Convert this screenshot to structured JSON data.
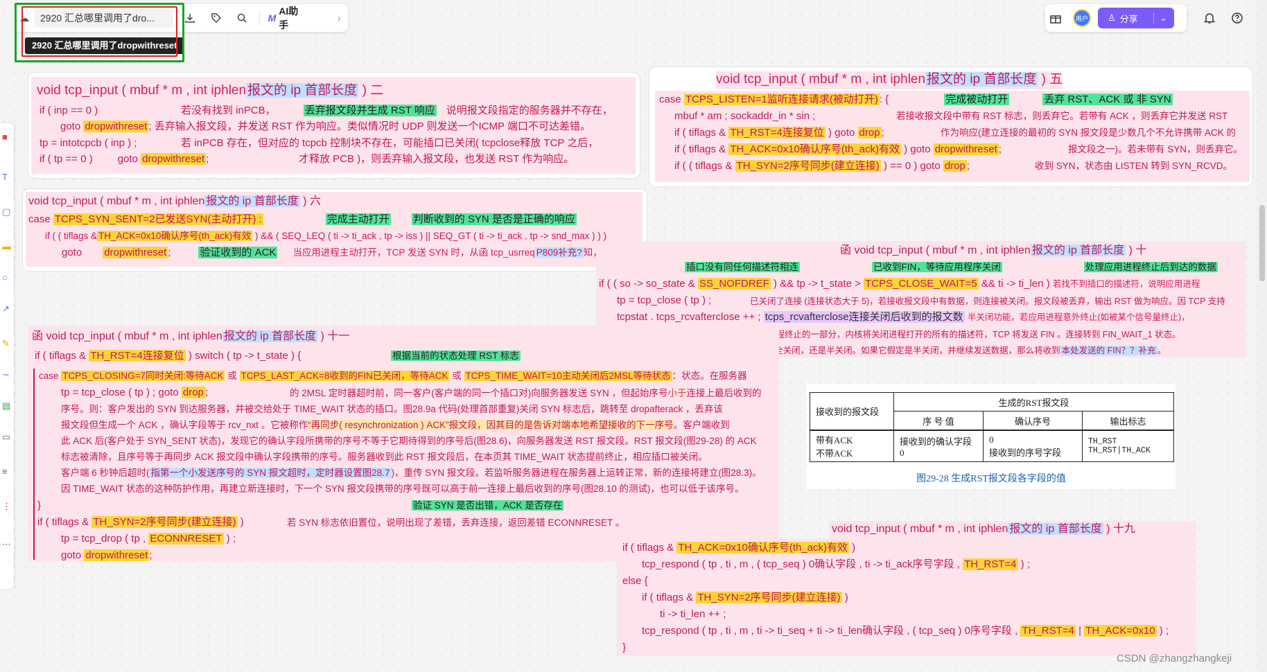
{
  "toolbar": {
    "doc_title": "2920 汇总哪里调用了dro...",
    "tooltip": "2920 汇总哪里调用了dropwithreset",
    "ai_label": "AI助手",
    "more_glyph": "›"
  },
  "right_toolbar": {
    "avatar_label": "用户",
    "share_label": "分享"
  },
  "card2": {
    "h_a": "void   tcp_input ( mbuf * m , int  iphlen",
    "h_b": "报文的 ip 首部长度",
    "h_c": " )    二",
    "l1_a": "if ( inp == 0 )",
    "l1_b": "若没有找到 inPCB，",
    "l1_c": "丢弃报文段并生成 RST 响应",
    "l1_d": "说明报文段指定的服务器并不存在，",
    "l2_a": "goto",
    "l2_b": "dropwithreset",
    "l2_c": ";   丢弃输入报文段，并发送 RST 作为响应。类似情况时 UDP 则发送一个ICMP 端口不可达差错。",
    "l3_a": "tp = intotcpcb ( inp ) ;",
    "l3_b": "若 inPCB 存在，但对应的 tcpcb 控制块不存在，可能插口已关闭( tcpclose释放 TCP 之后，",
    "l4_a": "if ( tp == 0 )",
    "l4_b": "goto",
    "l4_c": "dropwithreset",
    "l4_d": ";",
    "l4_e": "才释放 PCB )，则丢弃输入报文段，也发送 RST 作为响应。"
  },
  "card5": {
    "h_a": "void   tcp_input ( mbuf * m , int  iphlen",
    "h_b": "报文的 ip 首部长度",
    "h_c": " )    五",
    "l1_a": "case",
    "l1_b": "TCPS_LISTEN=1监听连接请求(被动打开)",
    "l1_c": ": {",
    "l1_d": "完成被动打开",
    "l1_e": "丢弃 RST、ACK 或 非 SYN",
    "l2_a": "mbuf * am ;      sockaddr_in * sin ;",
    "l2_b": "若接收报文段中带有 RST 标志，则丢弃它。若带有 ACK ，则丢弃它并发送 RST",
    "l3_a": "if ( tiflags  &",
    "l3_b": "TH_RST=4连接复位",
    "l3_c": " )     goto",
    "l3_d": "drop",
    "l3_e": ";",
    "l3_f": "作为响应(建立连接的最初的 SYN 报文段是少数几个不允许携带 ACK 的",
    "l4_a": "if ( tiflags  &",
    "l4_b": "TH_ACK=0x10确认序号(th_ack)有效",
    "l4_c": " )     goto",
    "l4_d": "dropwithreset",
    "l4_e": ";",
    "l4_f": "报文段之一)。若未带有 SYN，则丢弃它。",
    "l5_a": "if ( ( tiflags  &",
    "l5_b": "TH_SYN=2序号同步(建立连接)",
    "l5_c": " )  == 0 )     goto",
    "l5_d": "drop",
    "l5_e": ";",
    "l5_f": "收到 SYN，状态由 LISTEN 转到 SYN_RCVD。"
  },
  "card6": {
    "h_a": "void   tcp_input ( mbuf * m , int  iphlen",
    "h_b": "报文的 ip 首部长度",
    "h_c": " )   六",
    "l1_a": "case",
    "l1_b": "TCPS_SYN_SENT=2已发送SYN(主动打开) :",
    "l1_c": "完成主动打开",
    "l1_d": "判断收到的 SYN 是否是正确的响应",
    "l2_a": "if ( ( tiflags &",
    "l2_b": "TH_ACK=0x10确认序号(th_ack)有效",
    "l2_c": " )  && ( SEQ_LEQ ( ti -> ti_ack , tp -> iss ) || SEQ_GT ( ti -> ti_ack , tp -> snd_max ) ) )",
    "l3_a": "goto",
    "l3_b": "dropwithreset",
    "l3_c": ";",
    "l3_d": "验证收到的 ACK",
    "l3_e": "当应用进程主动打开，TCP 发送 SYN 时，从函 tcp_usrreq",
    "l3_f": "P809补充?",
    "l3_g": "知，"
  },
  "card10": {
    "h_a": "函    void   tcp_input ( mbuf * m , int  iphlen",
    "h_b": "报文的 ip 首部长度",
    "h_c": " ) 十",
    "l1_a": "插口没有同任何描述符相连",
    "l1_b": "已收到FIN，等待应用程序关闭",
    "l1_c": "处理应用进程终止后到达的数据",
    "l2_a": "if ( ( so -> so_state  &",
    "l2_b": "SS_NOFDREF",
    "l2_c": " )  && tp -> t_state  >",
    "l2_d": "TCPS_CLOSE_WAIT=5",
    "l2_e": " && ti -> ti_len )",
    "l2_f": "若找不到插口的描述符，说明应用进程",
    "l3_a": "tp = tcp_close ( tp ) ;",
    "l3_b": "已关闭了连接 (连接状态大于 5)，若接收报文段中有数据，则连接被关闭。报文段被丢弃，输出 RST 做为响应。因 TCP 支持",
    "l4_a": "tcpstat . tcps_rcvafterclose ++ ;",
    "l4_b": "tcps_rcvafterclose连接关闭后收到的报文数",
    "l4_c": "半关闭功能，若应用进程意外终止(如被某个信号量终止)，",
    "l5_a": "goto",
    "l5_b": "dropwithreset",
    "l5_c": ";",
    "l5_d": "做为进程终止的一部分，内核将关闭进程打开的所有的描述符，TCP 将发送 FIN 。连接转到 FIN_WAIT_1 状态。",
    "l6_a": "因 FIN 的接收者无法知道对端执行的是完全关闭，还是半关闭。如果它假定是半关闭，并继续发送数据，那么将收到",
    "l6_b": "本处发送的 FIN？？补充",
    "l6_c": "。"
  },
  "card11": {
    "h_a": "函    void   tcp_input ( mbuf * m , int  iphlen",
    "h_b": "报文的 ip 首部长度",
    "h_c": " ) 十一",
    "l1_a": "if ( tiflags  &",
    "l1_b": "TH_RST=4连接复位",
    "l1_c": " )    switch ( tp -> t_state ) {",
    "l1_d": "根据当前的状态处理 RST 标志",
    "l2_a": "case",
    "l2_b": "TCPS_CLOSING=7同时关闭:等待ACK",
    "l2_c": "或",
    "l2_d": "TCPS_LAST_ACK=8收到的FIN已关闭，等待ACK",
    "l2_e": "或",
    "l2_f": "TCPS_TIME_WAIT=10主动关闭后2MSL等待状态",
    "l2_g": "：状态。在服务器",
    "l3_a": "tp = tcp_close ( tp ) ;       goto",
    "l3_b": "drop",
    "l3_c": ";",
    "l3_d": "的 2MSL 定时器超时前，同一客户(客户端的同一个插口对)向服务器发送 SYN ，但起始序号",
    "l3_e": "小于",
    "l3_f": "连接上最后收到的",
    "l4": "序号。则：客户发出的 SYN 到达服务器，并被交给处于 TIME_WAIT 状态的插口。图28.9a 代码(处理首部重复)关闭 SYN 标志后，跳转至 dropafterack ，丢弃该",
    "l5_a": "报文段但生成一个 ACK ，确认字段等于 rcv_nxt 。它被称作",
    "l5_b": "“再同步( resynchronization ) ACK”报文段，因其目的是告诉对端本地希望接收的下一序号",
    "l5_c": "。客户端收到",
    "l6": "此 ACK 后(客户处于 SYN_SENT 状态)，发现它的确认字段所携带的序号不等于它期待得到的序号后(图28.6)，向服务器发送 RST 报文段。RST 报文段(图29-28) 的 ACK",
    "l7": "标志被清除，且序号等于再同步 ACK 报文段中确认字段携带的序号。服务器收到此 RST 报文段后，在本页其 TIME_WAIT 状态提前终止，相应插口被关闭。",
    "l8_a": "客户端 6 秒钟后超时(",
    "l8_b": "指第一个小发送序号的 SYN 报文超时，定时器设置图28.7",
    "l8_c": ")，重传 SYN 报文段。若监听服务器进程在服务器上运转正常，新的连接将建立(图28.3)。",
    "l9": "因  TIME_WAIT 状态的这种防护作用，再建立新连接时，下一个 SYN 报文段携带的序号既可以高于前一连接上最后收到的序号(图28.10 的测试)，也可以低于该序号。",
    "l10_a": "}",
    "l10_b": "验证 SYN 是否出错，ACK 是否存在",
    "l11_a": "if  ( tiflags  &",
    "l11_b": "TH_SYN=2序号同步(建立连接)",
    "l11_c": " )",
    "l11_d": "若 SYN 标志依旧置位，说明出现了差错，丢弃连接，返回差错 ECONNRESET 。",
    "l12_a": "tp = tcp_drop ( tp ,",
    "l12_b": "ECONNRESET",
    "l12_c": " ) ;",
    "l13_a": "goto",
    "l13_b": "dropwithreset",
    "l13_c": ";"
  },
  "card19": {
    "h_a": "void   tcp_input ( mbuf * m , int  iphlen",
    "h_b": "报文的 ip 首部长度",
    "h_c": " ) 十九",
    "l1_a": "if ( tiflags  &",
    "l1_b": "TH_ACK=0x10确认序号(th_ack)有效",
    "l1_c": " )",
    "l2_a": "tcp_respond ( tp , ti , m , ( tcp_seq ) 0确认字段 , ti -> ti_ack序号字段 ,",
    "l2_b": "TH_RST=4",
    "l2_c": " ) ;",
    "l3": "else {",
    "l4_a": "if ( tiflags  &",
    "l4_b": "TH_SYN=2序号同步(建立连接)",
    "l4_c": " )",
    "l5": "ti -> ti_len ++ ;",
    "l6_a": "tcp_respond ( tp , ti , m , ti -> ti_seq + ti -> ti_len确认字段 , ( tcp_seq ) 0序号字段 ,",
    "l6_b": "TH_RST=4",
    "l6_c": "|",
    "l6_d": "TH_ACK=0x10",
    "l6_e": " ) ;",
    "l7": "}"
  },
  "rst_table": {
    "header_group": "生成的RST报文段",
    "col_recv": "接收到的报文段",
    "col_seq": "序  号  值",
    "col_ack": "确认序号",
    "col_flags": "输出标志",
    "row_recv": [
      "带有ACK",
      "不带ACK"
    ],
    "row_seq": [
      "接收到的确认字段",
      "0"
    ],
    "row_ack": [
      "0",
      "接收到的序号字段"
    ],
    "row_flags": [
      "TH_RST",
      "TH_RST|TH_ACK"
    ],
    "caption": "图29-28   生成RST报文段各字段的值"
  },
  "watermark": "CSDN @zhangzhangkeji"
}
